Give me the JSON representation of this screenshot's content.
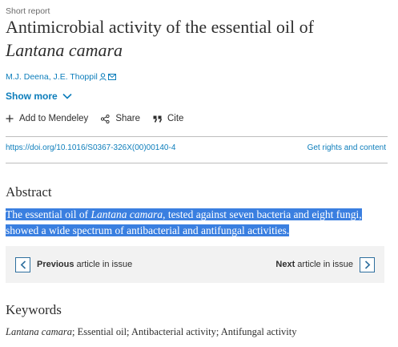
{
  "article": {
    "type": "Short report",
    "title_line1": "Antimicrobial activity of the essential oil of",
    "title_line2": "Lantana camara",
    "authors": "M.J. Deena, J.E. Thoppil",
    "show_more": "Show more"
  },
  "actions": {
    "mendeley": "Add to Mendeley",
    "share": "Share",
    "cite": "Cite"
  },
  "links": {
    "doi": "https://doi.org/10.1016/S0367-326X(00)00140-4",
    "rights": "Get rights and content"
  },
  "abstract": {
    "heading": "Abstract",
    "part1": "The essential oil of ",
    "species": "Lantana camara",
    "part2": ", tested against seven bacteria and eight fungi, showed a wide spectrum of antibacterial and antifungal activities."
  },
  "pager": {
    "prev_bold": "Previous",
    "prev_rest": " article in issue",
    "next_bold": "Next",
    "next_rest": " article in issue"
  },
  "keywords": {
    "heading": "Keywords",
    "k1": "Lantana camara",
    "rest": "; Essential oil; Antibacterial activity; Antifungal activity"
  },
  "colors": {
    "link": "#0c7dbb",
    "highlight": "#3a7fe0",
    "pager_bg": "#f2f2f2"
  },
  "icons": [
    "person-icon",
    "email-icon",
    "chevron-down-icon",
    "plus-icon",
    "share-icon",
    "quote-icon",
    "chevron-left-icon",
    "chevron-right-icon"
  ]
}
